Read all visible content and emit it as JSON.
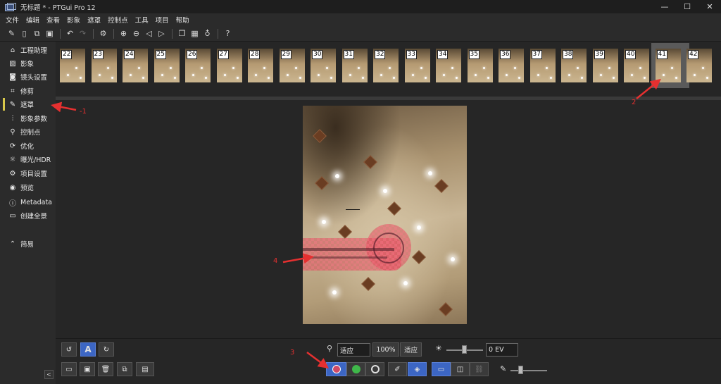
{
  "window": {
    "title": "无标题 * - PTGui Pro 12",
    "minimize_icon": "—",
    "maximize_icon": "☐",
    "close_icon": "✕"
  },
  "menu": [
    "文件",
    "编辑",
    "查看",
    "影象",
    "遮罩",
    "控制点",
    "工具",
    "项目",
    "帮助"
  ],
  "sidebar": {
    "items": [
      {
        "label": "工程助理",
        "icon": "home-icon",
        "glyph": "⌂"
      },
      {
        "label": "影象",
        "icon": "image-icon",
        "glyph": "▨"
      },
      {
        "label": "镜头设置",
        "icon": "camera-icon",
        "glyph": "◙"
      },
      {
        "label": "修剪",
        "icon": "crop-icon",
        "glyph": "⌗"
      },
      {
        "label": "遮罩",
        "icon": "brush-icon",
        "glyph": "✎"
      },
      {
        "label": "影象参数",
        "icon": "sliders-icon",
        "glyph": "⫶"
      },
      {
        "label": "控制点",
        "icon": "control-points-icon",
        "glyph": "⚲"
      },
      {
        "label": "优化",
        "icon": "optimize-icon",
        "glyph": "⟳"
      },
      {
        "label": "曝光/HDR",
        "icon": "sun-icon",
        "glyph": "☼"
      },
      {
        "label": "项目设置",
        "icon": "gear-icon",
        "glyph": "⚙"
      },
      {
        "label": "预览",
        "icon": "eye-icon",
        "glyph": "◉"
      },
      {
        "label": "Metadata",
        "icon": "info-icon",
        "glyph": "ⓘ"
      },
      {
        "label": "创建全景",
        "icon": "panorama-icon",
        "glyph": "▭"
      }
    ],
    "simple_label": "简易",
    "simple_glyph": "⌃",
    "collapse_glyph": "<"
  },
  "thumbnails": [
    "22",
    "23",
    "24",
    "25",
    "26",
    "27",
    "28",
    "29",
    "30",
    "31",
    "32",
    "33",
    "34",
    "35",
    "36",
    "37",
    "38",
    "39",
    "40",
    "41",
    "42"
  ],
  "selected_thumbnail": "41",
  "annotations": {
    "a1": "-1",
    "a2": "2",
    "a3": "3",
    "a4": "4"
  },
  "bottom": {
    "rotate_left": "↺",
    "auto": "A",
    "rotate_right": "↻",
    "zoom_icon": "⚲",
    "zoom_value": "适应",
    "zoom_100": "100%",
    "fit_label": "适应",
    "brightness_icon": "☀",
    "ev_value": "0 EV",
    "open": "▭",
    "save": "▣",
    "delete": "🗑",
    "copy": "⧉",
    "paste": "▤",
    "eraser": "✐",
    "fill": "◈",
    "single_view": "▭",
    "dual_view": "◫",
    "link": "⛓",
    "pen": "✎"
  },
  "colors": {
    "accent_blue": "#3c66c4",
    "mask_red": "#dc3c50",
    "keep_green": "#3fb84a",
    "annotation_red": "#e53030",
    "active_bar": "#d8c84a"
  }
}
